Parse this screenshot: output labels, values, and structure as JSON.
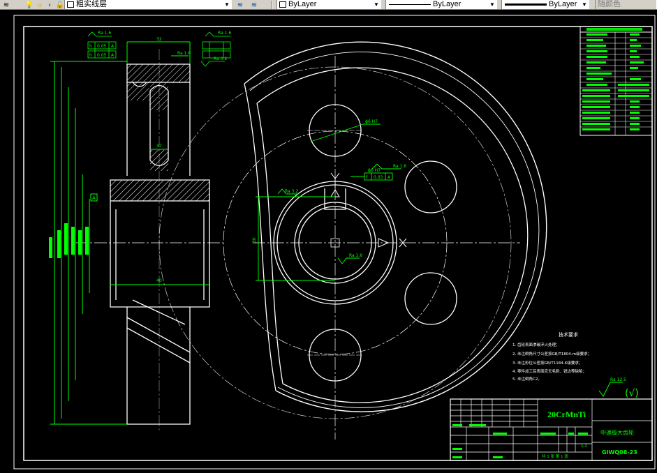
{
  "toolbar": {
    "layer_name": "粗实线层",
    "color_value": "ByLayer",
    "linetype_value": "ByLayer",
    "lineweight_value": "ByLayer",
    "plot_style": "随颜色"
  },
  "title_block": {
    "material": "20CrMnTi",
    "part_name": "中速级大齿轮",
    "drawing_no": "GIWQ08-23",
    "scale": "1:2",
    "sheet": "共 1 张  第 1 张"
  },
  "dimensions": {
    "center_distance": "30",
    "width_top": "32",
    "width_bottom": "40",
    "web": "37",
    "bore_tol_label": "ϕ6 H7",
    "hole_dia": "ϕ6 H7",
    "keyway": "Ra 1.6"
  },
  "roughness": {
    "r1": "Ra 1.6",
    "r2": "Ra 1.6",
    "r3": "Ra 3.2",
    "r4": "Ra 3.2",
    "r5": "Ra 1.6",
    "overall": "Ra 12.5",
    "overall_suffix": "(√)"
  },
  "tolerance_frames": {
    "f1": [
      "h",
      "0.05",
      "A"
    ],
    "f2": [
      "h",
      "0.05",
      "A"
    ],
    "f3": [
      "f",
      "0.03",
      "A"
    ]
  },
  "tech_requirements": {
    "title": "技术要求",
    "items": [
      "1. 齿轮表面渗碳淬火处理；",
      "2. 未注倒角尺寸公差按GB/T1804-m级要求；",
      "3. 未注形位公差按GB/T1184-K级要求；",
      "4. 零件加工后表面应无毛刺、锐边等缺陷；",
      "5. 未注倒角C2。"
    ]
  }
}
